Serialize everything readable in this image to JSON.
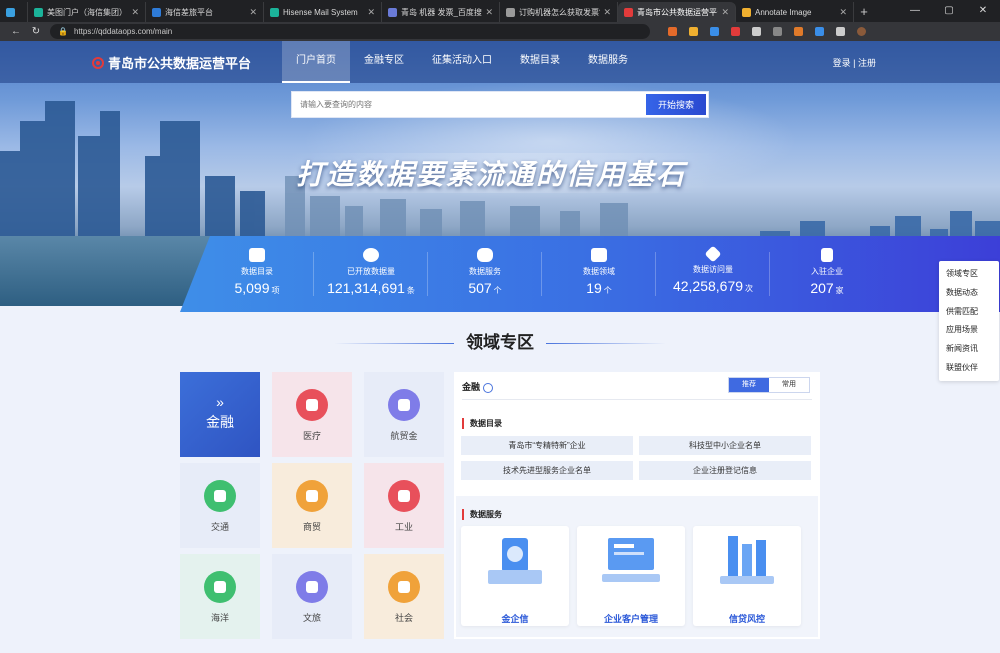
{
  "browser": {
    "tabs": [
      {
        "label": "",
        "color": "#3aa0e0",
        "small": true
      },
      {
        "label": "美图门户（海信集团）",
        "color": "#1bb39a"
      },
      {
        "label": "海信差旅平台",
        "color": "#2e7bd8"
      },
      {
        "label": "Hisense Mail System",
        "color": "#1bb39a"
      },
      {
        "label": "青岛 机器 发票_百度搜索",
        "color": "#6a7bd8"
      },
      {
        "label": "订购机器怎么获取发票? -仅限",
        "color": "#9a9a9a"
      },
      {
        "label": "青岛市公共数据运营平台",
        "color": "#e23b3b",
        "active": true
      },
      {
        "label": "Annotate Image",
        "color": "#f0b030"
      }
    ],
    "new_tab": "+",
    "window_controls": [
      "—",
      "▢",
      "✕"
    ],
    "url": "https://qddataops.com/main"
  },
  "site": {
    "logo_text": "青岛市公共数据运营平台",
    "nav": [
      "门户首页",
      "金融专区",
      "征集活动入口",
      "数据目录",
      "数据服务"
    ],
    "nav_active": 0,
    "login": "登录",
    "separator": "|",
    "register": "注册",
    "search_placeholder": "请输入要查询的内容",
    "search_button": "开始搜索",
    "slogan": "打造数据要素流通的信用基石"
  },
  "stats": [
    {
      "label": "数据目录",
      "value": "5,099",
      "unit": "项"
    },
    {
      "label": "已开放数据量",
      "value": "121,314,691",
      "unit": "条"
    },
    {
      "label": "数据服务",
      "value": "507",
      "unit": "个"
    },
    {
      "label": "数据领域",
      "value": "19",
      "unit": "个"
    },
    {
      "label": "数据访问量",
      "value": "42,258,679",
      "unit": "次"
    },
    {
      "label": "入驻企业",
      "value": "207",
      "unit": "家"
    }
  ],
  "section_title": "领域专区",
  "domains": [
    {
      "label": "金融",
      "featured": true,
      "chev": "»"
    },
    {
      "label": "医疗",
      "bg": "#f6e4ea",
      "color": "#e8505b"
    },
    {
      "label": "航贸金",
      "bg": "#e7ecf8",
      "color": "#7f7ce8"
    },
    {
      "label": "交通",
      "bg": "#e7ecf8",
      "color": "#3fbf70"
    },
    {
      "label": "商贸",
      "bg": "#f8ecdc",
      "color": "#f0a23a"
    },
    {
      "label": "工业",
      "bg": "#f6e4ea",
      "color": "#e8505b"
    },
    {
      "label": "海洋",
      "bg": "#e4f2ee",
      "color": "#3fbf70"
    },
    {
      "label": "文旅",
      "bg": "#e7ecf8",
      "color": "#7f7ce8"
    },
    {
      "label": "社会",
      "bg": "#f8ecdc",
      "color": "#f0a23a"
    }
  ],
  "panel": {
    "title": "金融",
    "switch": [
      "推荐",
      "常用"
    ],
    "catalog_title": "数据目录",
    "catalog": [
      "青岛市“专精特新”企业",
      "科技型中小企业名单",
      "技术先进型服务企业名单",
      "企业注册登记信息"
    ],
    "services_title": "数据服务",
    "services": [
      "金企信",
      "企业客户管理",
      "信贷风控"
    ]
  },
  "sidenav": [
    "领域专区",
    "数据动态",
    "供需匹配",
    "应用场景",
    "新闻资讯",
    "联盟伙伴"
  ]
}
